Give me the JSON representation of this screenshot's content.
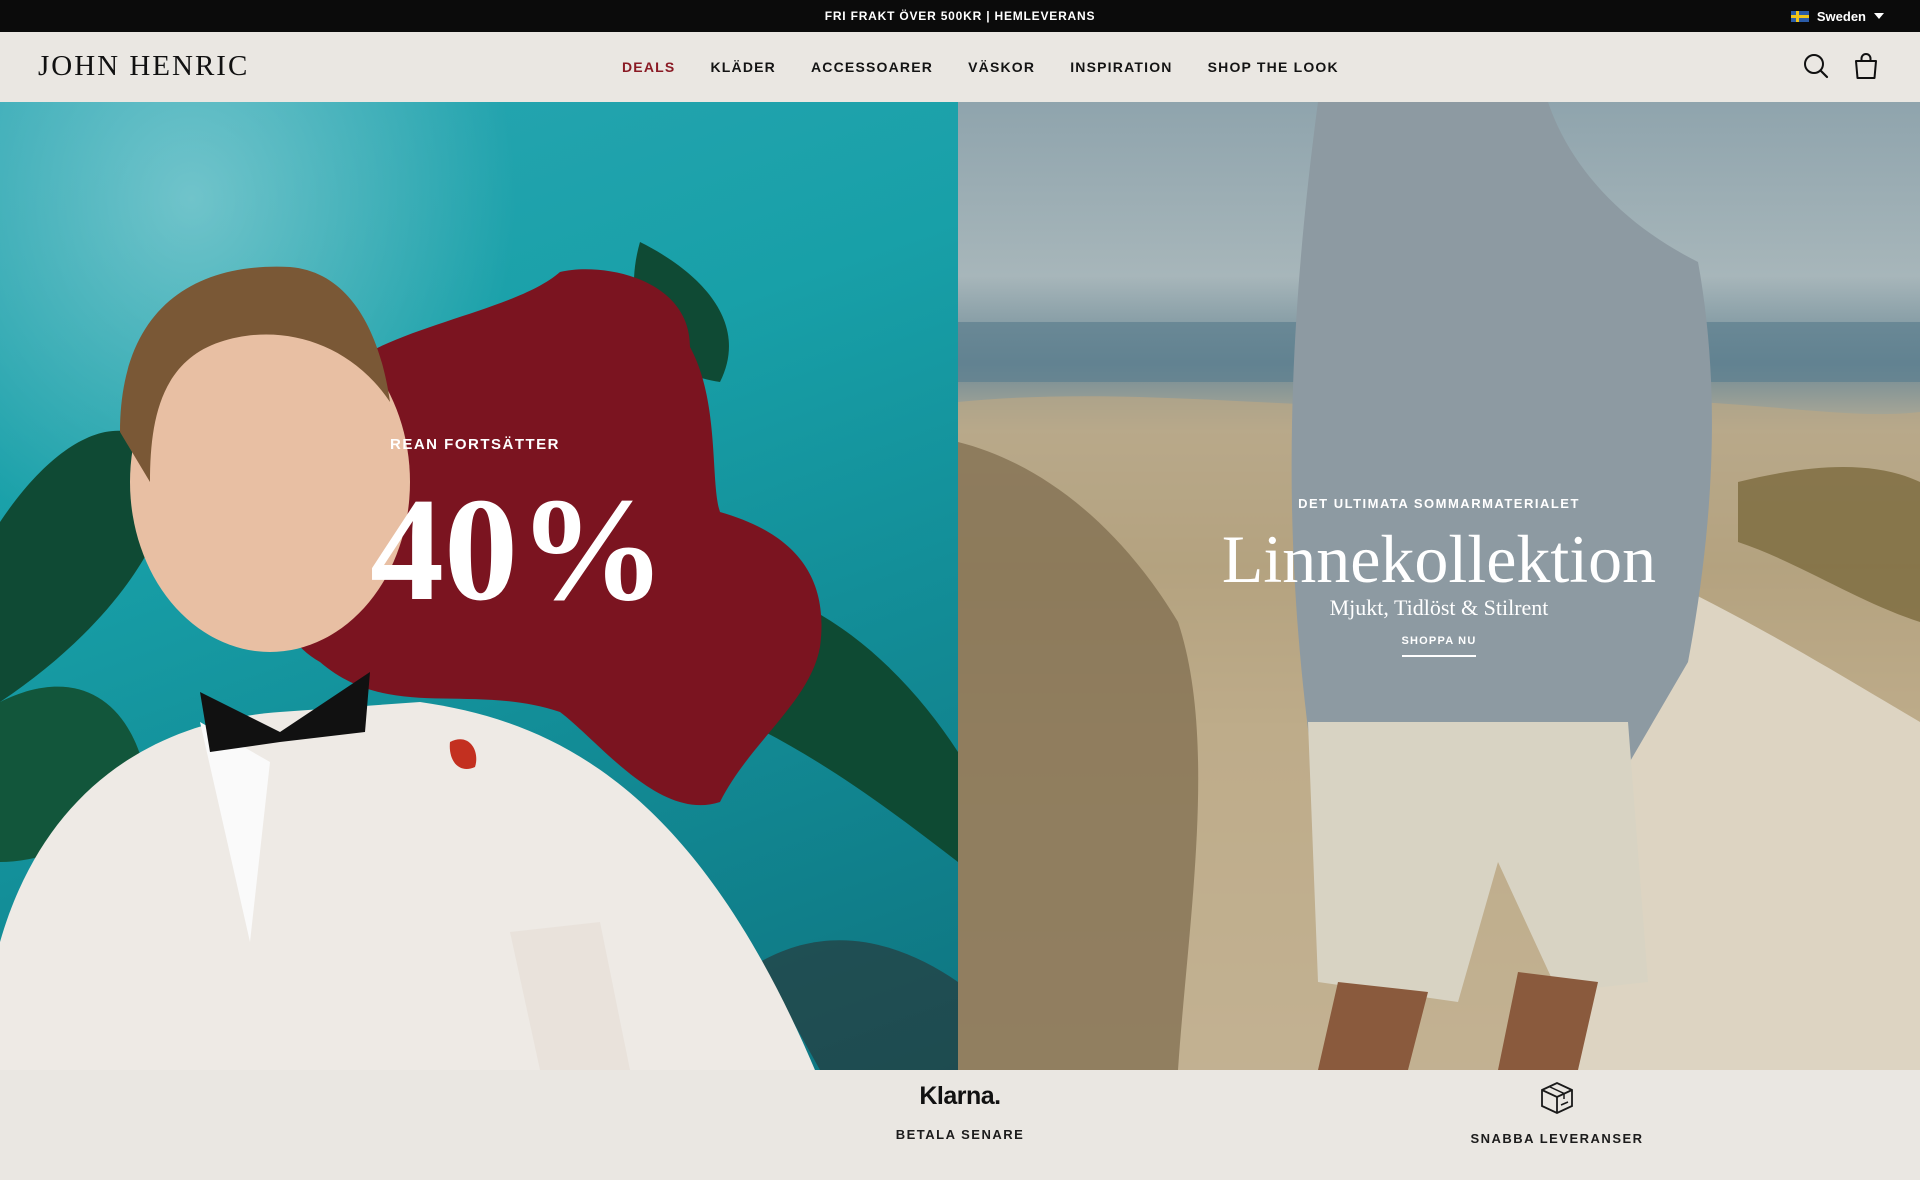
{
  "topbar": {
    "promo": "FRI FRAKT ÖVER 500KR | HEMLEVERANS",
    "country": "Sweden",
    "flag_icon": "sweden-flag-icon"
  },
  "header": {
    "logo": "JOHN HENRIC",
    "nav": [
      {
        "label": "DEALS",
        "active": true
      },
      {
        "label": "KLÄDER"
      },
      {
        "label": "ACCESSOARER"
      },
      {
        "label": "VÄSKOR"
      },
      {
        "label": "INSPIRATION"
      },
      {
        "label": "SHOP THE LOOK"
      }
    ],
    "icons": [
      "search-icon",
      "cart-icon"
    ]
  },
  "hero_left": {
    "sub": "REAN FORTSÄTTER",
    "big": "40%"
  },
  "hero_right": {
    "eyebrow": "DET ULTIMATA SOMMARMATERIALET",
    "headline": "Linnekollektion",
    "subline": "Mjukt, Tidlöst & Stilrent",
    "cta": "SHOPPA NU"
  },
  "benefits": [
    {
      "brand": "Klarna.",
      "label": "BETALA SENARE"
    },
    {
      "icon": "package-icon",
      "label": "SNABBA LEVERANSER"
    }
  ],
  "colors": {
    "accent": "#8a1a24",
    "topbar_bg": "#0b0b0b",
    "header_bg": "#eae7e2"
  }
}
